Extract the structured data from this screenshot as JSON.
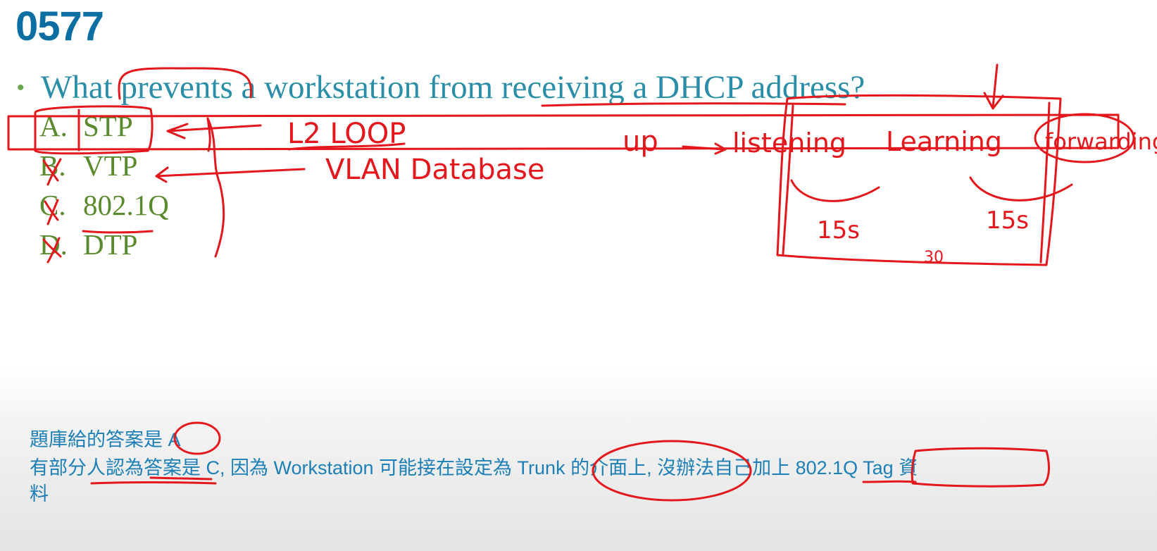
{
  "slide": {
    "number": "0577",
    "bullet": "•",
    "question": "What prevents a workstation from receiving a DHCP address?",
    "options": [
      {
        "letter": "A.",
        "text": "STP"
      },
      {
        "letter": "B.",
        "text": "VTP"
      },
      {
        "letter": "C.",
        "text": "802.1Q"
      },
      {
        "letter": "D.",
        "text": "DTP"
      }
    ],
    "notes": [
      "題庫給的答案是 A",
      "有部分人認為答案是 C, 因為 Workstation 可能接在設定為 Trunk 的介面上, 沒辦法自己加上 802.1Q Tag 資",
      "料"
    ]
  },
  "annotations": {
    "l2_loop": "L2 LOOP",
    "vlan_database": "VLAN Database",
    "up": "up",
    "listening": "listening",
    "learning": "Learning",
    "forwarding": "forwarding",
    "time_left": "15s",
    "time_right": "15s",
    "total": "30",
    "ink_color": "#e3171c"
  },
  "colors": {
    "number": "#0b6fa4",
    "question": "#2a8ea8",
    "options": "#5a8a2e",
    "notes": "#1c7fb5"
  }
}
